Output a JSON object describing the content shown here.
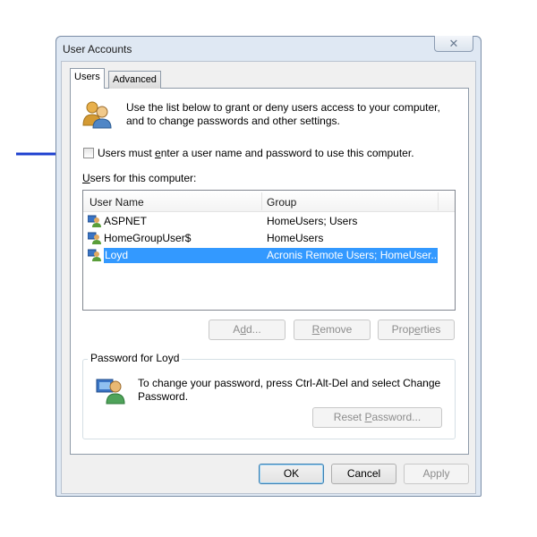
{
  "window": {
    "title": "User Accounts",
    "close_glyph": "✕"
  },
  "tabs": [
    {
      "label": "Users",
      "active": true
    },
    {
      "label": "Advanced",
      "active": false
    }
  ],
  "intro": {
    "text": "Use the list below to grant or deny users access to your computer, and to change passwords and other settings.",
    "icon": "users-group-icon"
  },
  "annotation": {
    "arrow_color": "#1c3fcf",
    "icon": "arrow-right-icon"
  },
  "login_checkbox": {
    "label_before": "Users must ",
    "label_access": "e",
    "label_after": "nter a user name and password to use this computer.",
    "checked": false
  },
  "users_list": {
    "label_access": "U",
    "label_rest": "sers for this computer:",
    "columns": [
      "User Name",
      "Group"
    ],
    "rows": [
      {
        "name": "ASPNET",
        "group": "HomeUsers; Users",
        "selected": false
      },
      {
        "name": "HomeGroupUser$",
        "group": "HomeUsers",
        "selected": false
      },
      {
        "name": "Loyd",
        "group": "Acronis Remote Users; HomeUser...",
        "selected": true
      }
    ],
    "selection_color": "#3399ff"
  },
  "list_buttons": {
    "add": {
      "before": "A",
      "access": "d",
      "after": "d...",
      "enabled": false
    },
    "remove": {
      "before": "",
      "access": "R",
      "after": "emove",
      "enabled": false
    },
    "properties": {
      "before": "Prop",
      "access": "e",
      "after": "rties",
      "enabled": false
    }
  },
  "password_group": {
    "legend": "Password for Loyd",
    "text": "To change your password, press Ctrl-Alt-Del and select Change Password.",
    "reset_before": "Reset ",
    "reset_access": "P",
    "reset_after": "assword...",
    "reset_enabled": false
  },
  "dialog_buttons": {
    "ok": "OK",
    "cancel": "Cancel",
    "apply": "Apply",
    "apply_enabled": false
  }
}
